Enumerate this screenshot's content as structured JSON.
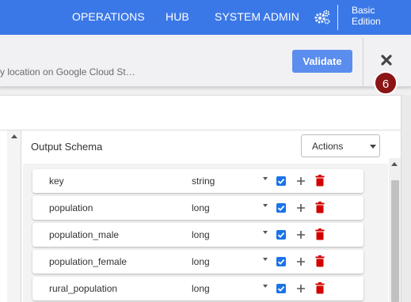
{
  "nav": {
    "items": [
      "OPERATIONS",
      "HUB",
      "SYSTEM ADMIN"
    ],
    "edition_line1": "Basic",
    "edition_line2": "Edition"
  },
  "plugin": {
    "description": "y location on Google Cloud St…",
    "validate_label": "Validate",
    "badge": "6"
  },
  "schema": {
    "title": "Output Schema",
    "actions_label": "Actions",
    "rows": [
      {
        "name": "key",
        "type": "string"
      },
      {
        "name": "population",
        "type": "long"
      },
      {
        "name": "population_male",
        "type": "long"
      },
      {
        "name": "population_female",
        "type": "long"
      },
      {
        "name": "rural_population",
        "type": "long"
      }
    ]
  },
  "colors": {
    "nav": "#3b78e7",
    "validate": "#5b8dee",
    "checkbox": "#1a73e8",
    "trash": "#d40000",
    "badge": "#8b1414"
  }
}
